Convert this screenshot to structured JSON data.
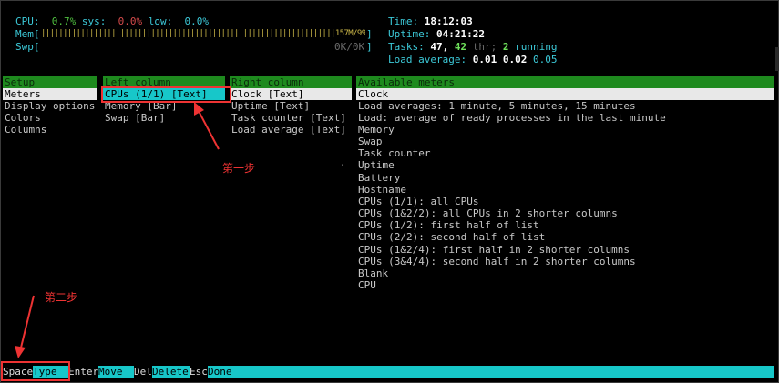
{
  "header": {
    "cpu_label": "CPU:",
    "cpu_user": "0.7%",
    "sys_label": "sys:",
    "cpu_sys": "0.0%",
    "low_label": "low:",
    "cpu_low": "0.0%",
    "mem_label": "Mem[",
    "mem_bar": "|||||||||||||||||||||||||||||||||||||||||||||||||||||||||||||||||||157M/993M",
    "mem_end": "]",
    "swp_label": "Swp[",
    "swp_bar": "0K/0K",
    "swp_end": "]",
    "time_label": "Time:",
    "time_value": "18:12:03",
    "uptime_label": "Uptime:",
    "uptime_value": "04:21:22",
    "tasks_label": "Tasks:",
    "tasks_total": "47,",
    "tasks_thr": "42",
    "thr_label": "thr;",
    "tasks_running": "2",
    "running_label": "running",
    "load_label": "Load average:",
    "load_1": "0.01",
    "load_5": "0.02",
    "load_15": "0.05"
  },
  "setup": {
    "header": "Setup",
    "items": [
      "Meters",
      "Display options",
      "Colors",
      "Columns"
    ]
  },
  "left_column": {
    "header": "Left column",
    "items": [
      "CPUs (1/1) [Text]",
      "Memory [Bar]",
      "Swap [Bar]"
    ]
  },
  "right_column": {
    "header": "Right column",
    "items": [
      "Clock [Text]",
      "Uptime [Text]",
      "Task counter [Text]",
      "Load average [Text]"
    ]
  },
  "available_meters": {
    "header": "Available meters",
    "items": [
      "Clock",
      "Load averages: 1 minute, 5 minutes, 15 minutes",
      "Load: average of ready processes in the last minute",
      "Memory",
      "Swap",
      "Task counter",
      "Uptime",
      "Battery",
      "Hostname",
      "CPUs (1/1): all CPUs",
      "CPUs (1&2/2): all CPUs in 2 shorter columns",
      "CPUs (1/2): first half of list",
      "CPUs (2/2): second half of list",
      "CPUs (1&2/4): first half in 2 shorter columns",
      "CPUs (3&4/4): second half in 2 shorter columns",
      "Blank",
      "CPU"
    ]
  },
  "function_bar": [
    {
      "key": "Space",
      "action": "Type"
    },
    {
      "key": "Enter",
      "action": "Move"
    },
    {
      "key": "Del",
      "action": "Delete"
    },
    {
      "key": "Esc",
      "action": "Done"
    }
  ],
  "annotations": {
    "step1": "第一步",
    "step2": "第二步",
    "color": "#ee3333"
  },
  "stray_dot": "."
}
